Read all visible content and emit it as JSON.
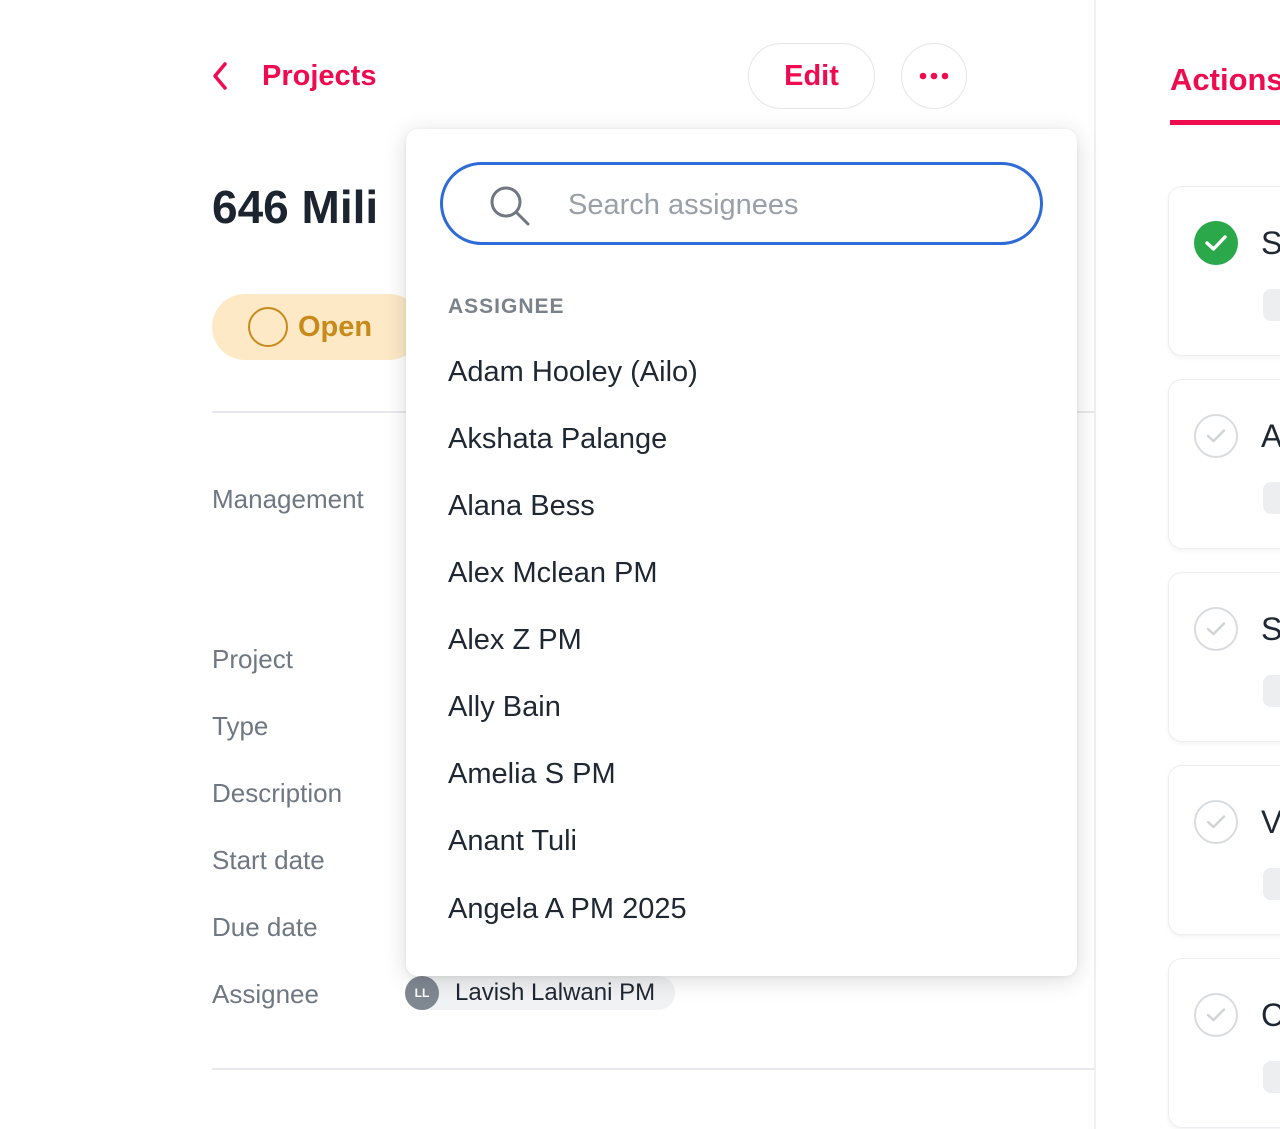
{
  "header": {
    "back_label": "Projects",
    "edit_label": "Edit",
    "more_icon": "ellipsis-icon"
  },
  "project": {
    "title": "646 Mili",
    "status": "Open"
  },
  "fields": {
    "management": "Management",
    "project": "Project",
    "type": "Type",
    "description": "Description",
    "start_date": "Start date",
    "due_date": "Due date",
    "assignee": "Assignee"
  },
  "assignee_chip": {
    "initials": "LL",
    "name": "Lavish Lalwani PM"
  },
  "right_panel": {
    "tab_label": "Actions",
    "cards": [
      {
        "letter": "S",
        "done": true
      },
      {
        "letter": "A",
        "done": false
      },
      {
        "letter": "S",
        "done": false
      },
      {
        "letter": "V",
        "done": false
      },
      {
        "letter": "C",
        "done": false
      }
    ]
  },
  "dropdown": {
    "search_placeholder": "Search assignees",
    "search_value": "",
    "section_label": "ASSIGNEE",
    "options": [
      "Adam Hooley (Ailo)",
      "Akshata Palange",
      "Alana Bess",
      "Alex Mclean PM",
      "Alex Z PM",
      "Ally Bain",
      "Amelia S PM",
      "Anant Tuli",
      "Angela A PM 2025"
    ]
  },
  "colors": {
    "accent": "#ee0b4f",
    "status_open_bg": "#fde9c6",
    "status_open_fg": "#c88a1b",
    "focus_blue": "#2f6bd8",
    "done_green": "#2aa84a"
  }
}
